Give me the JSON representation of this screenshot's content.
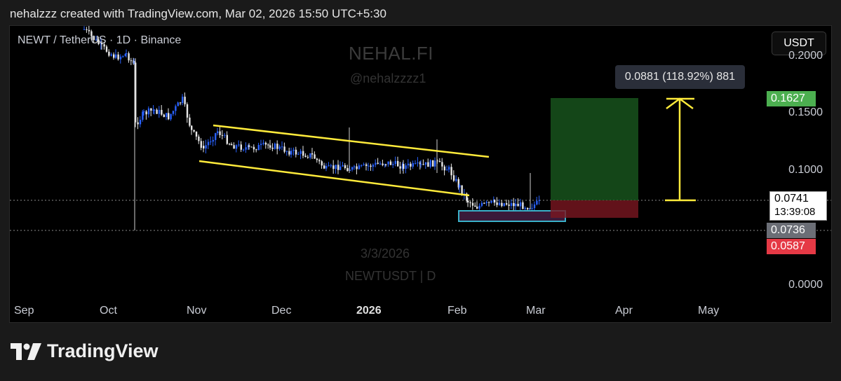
{
  "caption": "nehalzzz created with TradingView.com, Mar 02, 2026 15:50 UTC+5:30",
  "chart": {
    "symbol_line": "NEWT / TetherUS · 1D · Binance",
    "currency": "USDT",
    "watermark_name": "NEHAL.FI",
    "watermark_handle": "@nehalzzzz1",
    "watermark_date": "3/3/2026",
    "watermark_symbol": "NEWTUSDT | D",
    "measure_label": "0.0881 (118.92%) 881"
  },
  "price_axis": {
    "ticks": [
      "0.2000",
      "0.1500",
      "0.1000",
      "0.0000"
    ],
    "target_tag": "0.1627",
    "current_price": "0.0741",
    "countdown": "13:39:08",
    "entry_tag": "0.0736",
    "stop_tag": "0.0587"
  },
  "time_axis": {
    "months": [
      "Sep",
      "Oct",
      "Nov",
      "Dec",
      "2026",
      "Feb",
      "Mar",
      "Apr",
      "May"
    ]
  },
  "colors": {
    "bull_candle": "#2962ff",
    "bear_candle": "#e8e8e8",
    "channel_line": "#ffeb3b",
    "target_zone": "#1b5e20",
    "stop_zone": "#7a1720",
    "target_tag_bg": "#4caf50",
    "stop_tag_bg": "#e53945",
    "entry_tag_bg": "#6b6e76"
  },
  "chart_data": {
    "type": "candlestick",
    "ylim": [
      0,
      0.2
    ],
    "trade_setup": {
      "entry": 0.0736,
      "target": 0.1627,
      "stop": 0.0587,
      "current": 0.0741
    }
  },
  "brand": {
    "name": "TradingView"
  }
}
